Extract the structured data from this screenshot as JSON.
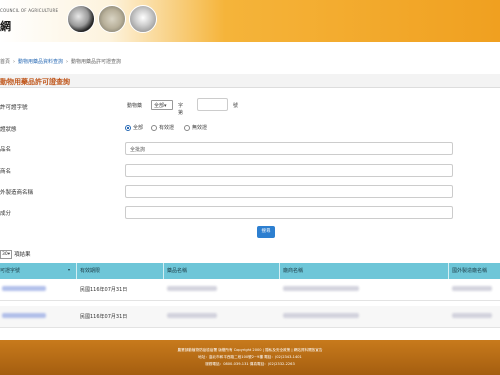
{
  "header": {
    "ministry": "COUNCIL OF AGRICULTURE",
    "site_title": "網"
  },
  "breadcrumb": {
    "home": "首頁",
    "section": "動物用藥品資料查詢",
    "current": "動物用藥品許可證查詢"
  },
  "page_title": "動物用藥品許可證查詢",
  "form": {
    "license_label": "許可證字號",
    "license_prefix": "動物藥",
    "license_select": "全部",
    "license_zi": "字第",
    "license_hao": "號",
    "status_label": "證狀態",
    "status_options": [
      "全部",
      "有效證",
      "無效證"
    ],
    "name_label": "品名",
    "name_placeholder": "全批詢",
    "field3_label": "商名",
    "field4_label": "外製造商名稱",
    "field5_label": "成分",
    "search_button": "搜尋"
  },
  "pagesize": {
    "value": "30",
    "suffix": "項結果"
  },
  "table": {
    "headers": [
      "可證字號",
      "有效期限",
      "藥品名稱",
      "廠商名稱",
      "國外製造廠名稱"
    ],
    "rows": [
      {
        "expiry": "民國116年07月31日"
      },
      {
        "expiry": "民國116年07月31日"
      }
    ]
  },
  "footer": {
    "line1": "農業部動植物防疫檢疫署 版權所有 Copyright 2000 | 隱私及安全政策 | 網站資料開放宣告",
    "line2": "地址：臺北市和平西路二段100號2~9樓 電話：(02)2343-1401",
    "line3": "服務電話：0800-039-131 傳真電話：(02)2332-2263"
  }
}
